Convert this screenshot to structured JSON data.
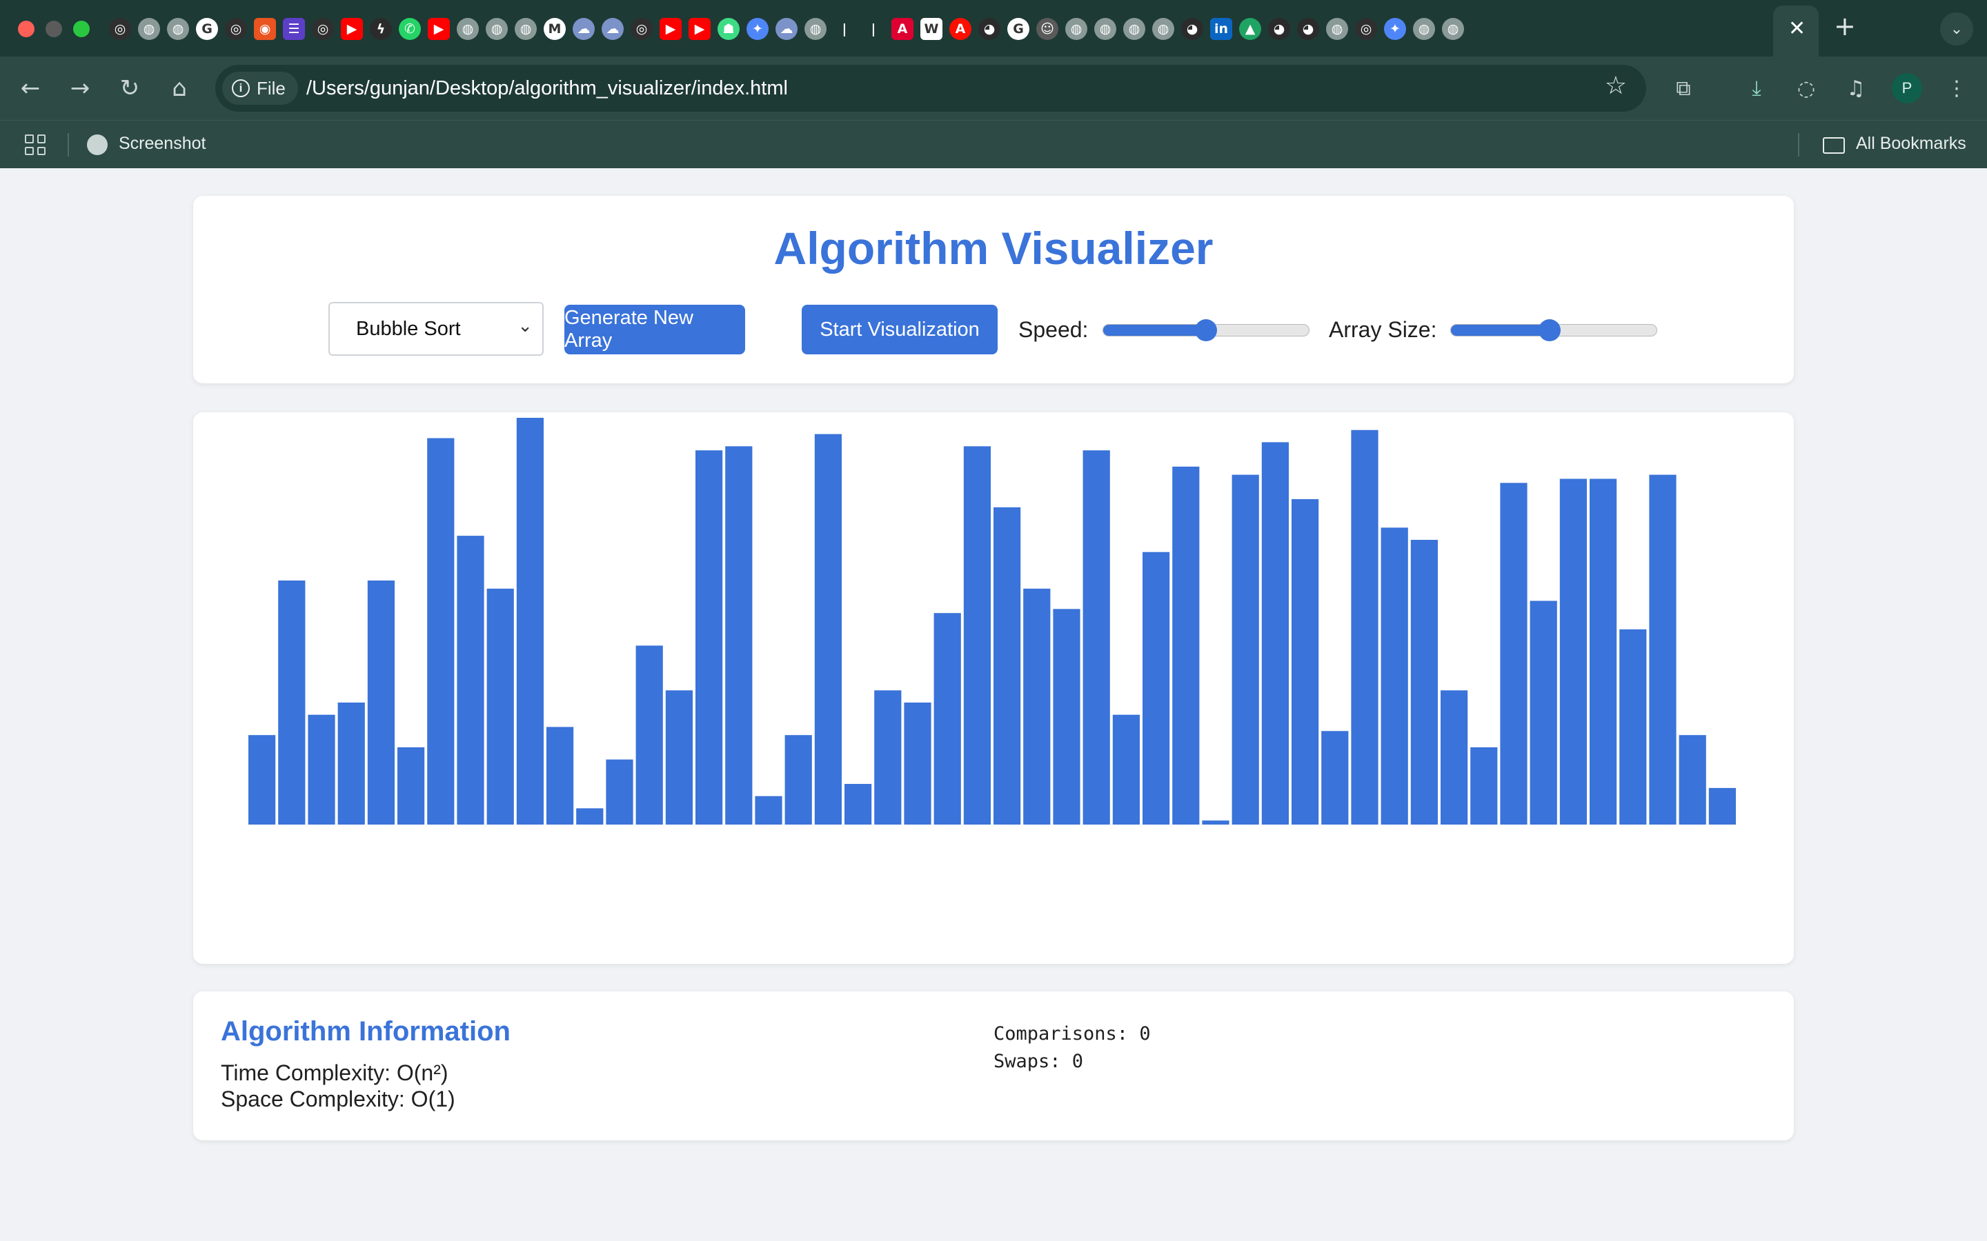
{
  "browser": {
    "tab_favicons": [
      {
        "icon": "openai-icon",
        "color": "#2f2f2f",
        "glyph": "◎"
      },
      {
        "icon": "globe-icon",
        "color": "#8a9a97",
        "glyph": "◍"
      },
      {
        "icon": "globe-icon",
        "color": "#8a9a97",
        "glyph": "◍"
      },
      {
        "icon": "google-icon",
        "color": "#ffffff",
        "glyph": "G"
      },
      {
        "icon": "openai-icon",
        "color": "#2f2f2f",
        "glyph": "◎"
      },
      {
        "icon": "ubuntu-icon",
        "color": "#e95420",
        "glyph": "◉"
      },
      {
        "icon": "list-icon",
        "color": "#5c3fc7",
        "glyph": "☰"
      },
      {
        "icon": "openai-icon",
        "color": "#2f2f2f",
        "glyph": "◎"
      },
      {
        "icon": "youtube-icon",
        "color": "#ff0000",
        "glyph": "▶"
      },
      {
        "icon": "lightning-icon",
        "color": "#2b2b2b",
        "glyph": "ϟ"
      },
      {
        "icon": "whatsapp-icon",
        "color": "#25d366",
        "glyph": "✆"
      },
      {
        "icon": "youtube-icon",
        "color": "#ff0000",
        "glyph": "▶"
      },
      {
        "icon": "globe-icon",
        "color": "#8a9a97",
        "glyph": "◍"
      },
      {
        "icon": "globe-icon",
        "color": "#8a9a97",
        "glyph": "◍"
      },
      {
        "icon": "globe-icon",
        "color": "#8a9a97",
        "glyph": "◍"
      },
      {
        "icon": "gmail-icon",
        "color": "#ffffff",
        "glyph": "M"
      },
      {
        "icon": "cloud-icon",
        "color": "#7b93c9",
        "glyph": "☁"
      },
      {
        "icon": "cloud-icon",
        "color": "#7b93c9",
        "glyph": "☁"
      },
      {
        "icon": "openai-icon",
        "color": "#2f2f2f",
        "glyph": "◎"
      },
      {
        "icon": "youtube-icon",
        "color": "#ff0000",
        "glyph": "▶"
      },
      {
        "icon": "youtube-icon",
        "color": "#ff0000",
        "glyph": "▶"
      },
      {
        "icon": "android-icon",
        "color": "#3ddc84",
        "glyph": "☗"
      },
      {
        "icon": "gemini-icon",
        "color": "#4f86f7",
        "glyph": "✦"
      },
      {
        "icon": "cloud-icon",
        "color": "#7b93c9",
        "glyph": "☁"
      },
      {
        "icon": "globe-icon",
        "color": "#8a9a97",
        "glyph": "◍"
      },
      {
        "icon": "bar-icon",
        "color": "#1e3a35",
        "glyph": "|"
      },
      {
        "icon": "bar-icon",
        "color": "#1e3a35",
        "glyph": "|"
      },
      {
        "icon": "angular-icon",
        "color": "#dd0031",
        "glyph": "A"
      },
      {
        "icon": "wix-icon",
        "color": "#ffffff",
        "glyph": "W"
      },
      {
        "icon": "adobe-icon",
        "color": "#fa0f00",
        "glyph": "A"
      },
      {
        "icon": "github-icon",
        "color": "#2b2b2b",
        "glyph": "◕"
      },
      {
        "icon": "google-icon",
        "color": "#ffffff",
        "glyph": "G"
      },
      {
        "icon": "avatar-icon",
        "color": "#5a5a5a",
        "glyph": "☺"
      },
      {
        "icon": "globe-icon",
        "color": "#8a9a97",
        "glyph": "◍"
      },
      {
        "icon": "globe-icon",
        "color": "#8a9a97",
        "glyph": "◍"
      },
      {
        "icon": "globe-icon",
        "color": "#8a9a97",
        "glyph": "◍"
      },
      {
        "icon": "globe-icon",
        "color": "#8a9a97",
        "glyph": "◍"
      },
      {
        "icon": "github-icon",
        "color": "#2b2b2b",
        "glyph": "◕"
      },
      {
        "icon": "linkedin-icon",
        "color": "#0a66c2",
        "glyph": "in"
      },
      {
        "icon": "drive-icon",
        "color": "#1fa463",
        "glyph": "▲"
      },
      {
        "icon": "github-icon",
        "color": "#2b2b2b",
        "glyph": "◕"
      },
      {
        "icon": "github-icon",
        "color": "#2b2b2b",
        "glyph": "◕"
      },
      {
        "icon": "globe-icon",
        "color": "#8a9a97",
        "glyph": "◍"
      },
      {
        "icon": "openai-icon",
        "color": "#2f2f2f",
        "glyph": "◎"
      },
      {
        "icon": "gemini-icon",
        "color": "#4f86f7",
        "glyph": "✦"
      },
      {
        "icon": "globe-icon",
        "color": "#8a9a97",
        "glyph": "◍"
      },
      {
        "icon": "globe-icon",
        "color": "#8a9a97",
        "glyph": "◍"
      }
    ],
    "address": {
      "chip_label": "File",
      "url": "/Users/gunjan/Desktop/algorithm_visualizer/index.html"
    },
    "profile_initial": "P",
    "bookmarks": {
      "item": "Screenshot",
      "all": "All Bookmarks"
    }
  },
  "header": {
    "title": "Algorithm Visualizer",
    "algorithm_select": "Bubble Sort",
    "generate_button": "Generate New Array",
    "start_button": "Start Visualization",
    "speed_label": "Speed:",
    "speed_value": 0.5,
    "size_label": "Array Size:",
    "size_value": 0.48
  },
  "chart_data": {
    "type": "bar",
    "ylim": [
      0,
      100
    ],
    "bar_color": "#3a73d9",
    "values": [
      22,
      60,
      27,
      30,
      60,
      19,
      95,
      71,
      58,
      100,
      24,
      4,
      16,
      44,
      33,
      92,
      93,
      7,
      22,
      96,
      10,
      33,
      30,
      52,
      93,
      78,
      58,
      53,
      92,
      27,
      67,
      88,
      1,
      86,
      94,
      80,
      23,
      97,
      73,
      70,
      33,
      19,
      84,
      55,
      85,
      85,
      48,
      86,
      22,
      9
    ]
  },
  "info": {
    "title": "Algorithm Information",
    "time_complexity": "Time Complexity: O(n²)",
    "space_complexity": "Space Complexity: O(1)",
    "comparisons": "Comparisons: 0",
    "swaps": "Swaps: 0"
  }
}
